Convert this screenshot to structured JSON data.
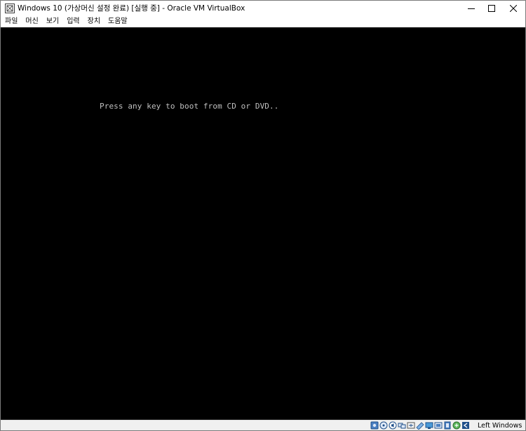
{
  "window": {
    "title": "Windows 10 (가상머신 설정 완료) [실행 중] - Oracle VM VirtualBox",
    "app_icon": "virtualbox-icon",
    "controls": [
      "minimize-icon",
      "maximize-icon",
      "close-icon"
    ]
  },
  "menubar": {
    "items": [
      {
        "label": "파일"
      },
      {
        "label": "머신"
      },
      {
        "label": "보기"
      },
      {
        "label": "입력"
      },
      {
        "label": "장치"
      },
      {
        "label": "도움말"
      }
    ]
  },
  "display": {
    "boot_message": "Press any key to boot from CD or DVD..",
    "background": "#000000",
    "text_color": "#c0c0c0"
  },
  "statusbar": {
    "icons": [
      "hard-disk-icon",
      "optical-drive-icon",
      "audio-icon",
      "network-icon",
      "usb-icon",
      "shared-folders-icon",
      "display-icon",
      "video-capture-icon",
      "cpu-icon",
      "mouse-integration-icon",
      "host-key-icon"
    ],
    "host_key": "Left Windows"
  }
}
